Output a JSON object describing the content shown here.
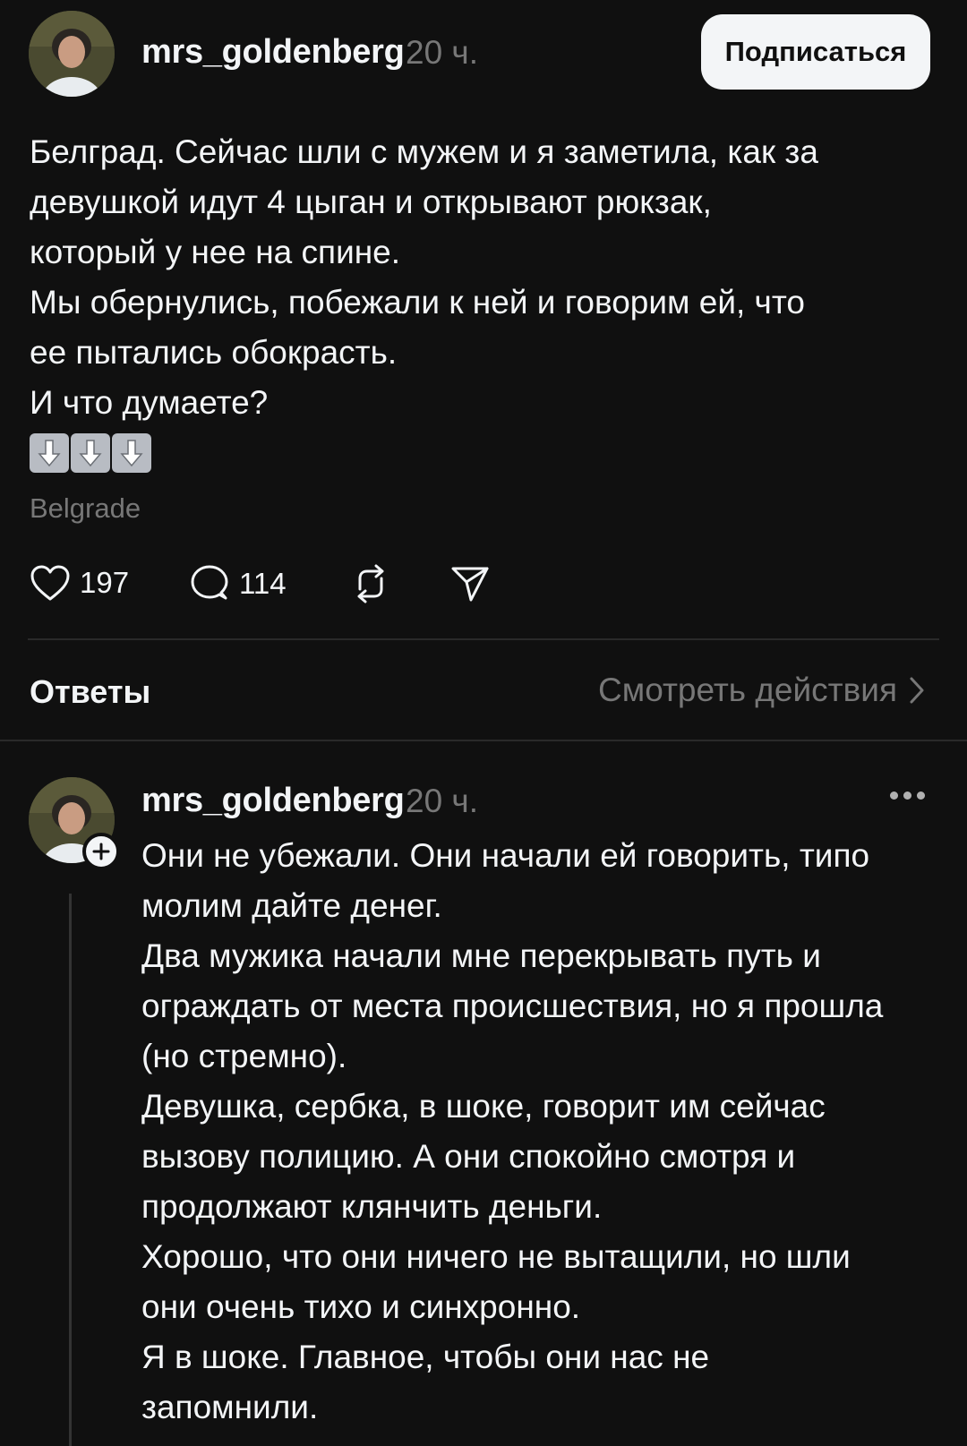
{
  "post": {
    "username": "mrs_goldenberg",
    "timestamp": "20 ч.",
    "subscribe_label": "Подписаться",
    "text_lines": [
      "Белград. Сейчас шли с мужем и я заметила, как за",
      "девушкой идут 4 цыган и открывают рюкзак,",
      "который у нее на спине.",
      "Мы обернулись, побежали к ней и говорим ей, что",
      "ее пытались обокрасть.",
      "И что думаете?"
    ],
    "emoji": [
      "down-arrow-emoji",
      "down-arrow-emoji",
      "down-arrow-emoji"
    ],
    "location": "Belgrade",
    "likes": "197",
    "comments": "114"
  },
  "replies_section": {
    "title": "Ответы",
    "view_activity_label": "Смотреть действия"
  },
  "reply": {
    "username": "mrs_goldenberg",
    "timestamp": "20 ч.",
    "text_lines": [
      "Они не убежали. Они начали ей говорить, типо",
      "молим дайте денег.",
      "Два мужика начали мне перекрывать путь и",
      "ограждать от места происшествия, но я прошла",
      "(но стремно).",
      "Девушка, сербка, в шоке, говорит им сейчас",
      "вызову полицию. А они спокойно смотря и",
      "продолжают клянчить деньги.",
      "Хорошо, что они ничего не вытащили, но шли",
      "они очень тихо и синхронно.",
      "Я в шоке. Главное, чтобы они нас не",
      "запомнили."
    ]
  },
  "colors": {
    "background": "#101010",
    "text_primary": "#f3f5f7",
    "text_secondary": "#777777",
    "divider": "#2a2a2a"
  }
}
